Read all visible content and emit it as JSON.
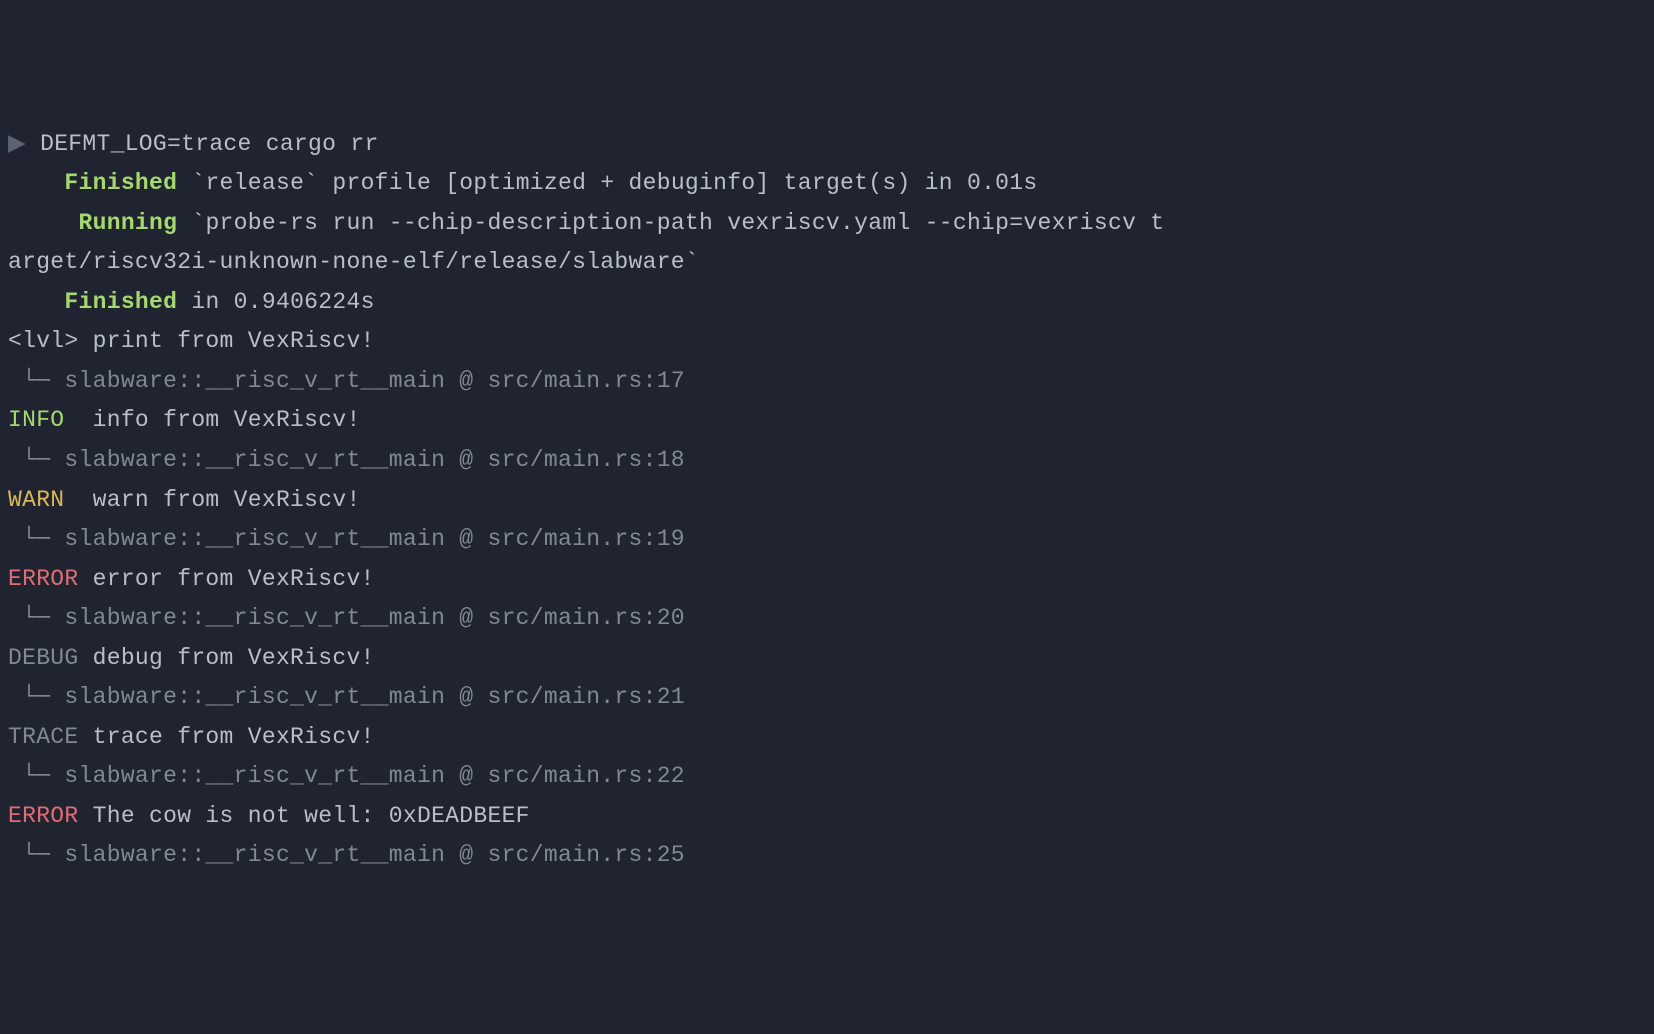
{
  "prompt": {
    "arrow": "▶ ",
    "cmd": "DEFMT_LOG=trace cargo rr"
  },
  "build": {
    "finished_label": "Finished",
    "finished_rest": " `release` profile [optimized + debuginfo] target(s) in 0.01s",
    "running_label": "Running",
    "running_rest_1": " `probe-rs run --chip-description-path vexriscv.yaml --chip=vexriscv t",
    "running_rest_2": "arget/riscv32i-unknown-none-elf/release/slabware`",
    "done_label": "Finished",
    "done_rest": " in 0.9406224s"
  },
  "indent4": "    ",
  "indent5": "     ",
  "logs": [
    {
      "level": "<lvl>",
      "level_class": "",
      "msg": " print from VexRiscv!",
      "loc": " └─ slabware::__risc_v_rt__main @ src/main.rs:17"
    },
    {
      "level": "INFO ",
      "level_class": "lvl-info",
      "msg": " info from VexRiscv!",
      "loc": " └─ slabware::__risc_v_rt__main @ src/main.rs:18"
    },
    {
      "level": "WARN ",
      "level_class": "lvl-warn",
      "msg": " warn from VexRiscv!",
      "loc": " └─ slabware::__risc_v_rt__main @ src/main.rs:19"
    },
    {
      "level": "ERROR",
      "level_class": "lvl-error",
      "msg": " error from VexRiscv!",
      "loc": " └─ slabware::__risc_v_rt__main @ src/main.rs:20"
    },
    {
      "level": "DEBUG",
      "level_class": "lvl-debug",
      "msg": " debug from VexRiscv!",
      "loc": " └─ slabware::__risc_v_rt__main @ src/main.rs:21"
    },
    {
      "level": "TRACE",
      "level_class": "lvl-trace",
      "msg": " trace from VexRiscv!",
      "loc": " └─ slabware::__risc_v_rt__main @ src/main.rs:22"
    },
    {
      "level": "ERROR",
      "level_class": "lvl-error",
      "msg": " The cow is not well: 0xDEADBEEF",
      "loc": " └─ slabware::__risc_v_rt__main @ src/main.rs:25"
    }
  ]
}
